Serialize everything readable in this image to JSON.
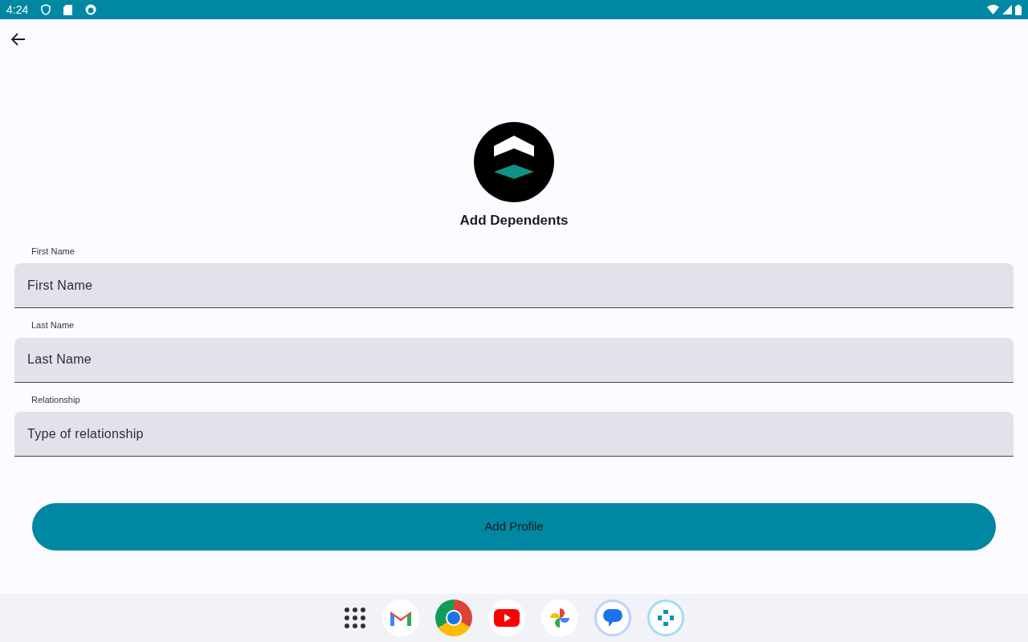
{
  "status_bar": {
    "time": "4:24"
  },
  "title": "Add Dependents",
  "fields": [
    {
      "label": "First Name",
      "placeholder": "First Name"
    },
    {
      "label": "Last Name",
      "placeholder": "Last Name"
    },
    {
      "label": "Relationship",
      "placeholder": "Type of relationship"
    }
  ],
  "submit_button": "Add Profile"
}
